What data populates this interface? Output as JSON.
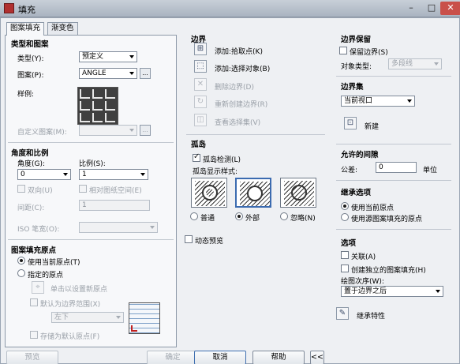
{
  "window": {
    "title": "填充",
    "minimize": "–",
    "maximize": "□",
    "close": "✕"
  },
  "tabs": [
    {
      "label": "图案填充"
    },
    {
      "label": "渐变色"
    }
  ],
  "type_pattern": {
    "group_title": "类型和图案",
    "type_label": "类型(Y):",
    "type_value": "预定义",
    "pattern_label": "图案(P):",
    "pattern_value": "ANGLE",
    "pattern_browse": "...",
    "sample_label": "样例:",
    "custom_label": "自定义图案(M):",
    "custom_value": "",
    "custom_browse": "..."
  },
  "angle_scale": {
    "group_title": "角度和比例",
    "angle_label": "角度(G):",
    "angle_value": "0",
    "scale_label": "比例(S):",
    "scale_value": "1",
    "double_label": "双向(U)",
    "relative_label": "相对图纸空间(E)",
    "spacing_label": "间距(C):",
    "spacing_value": "1",
    "iso_label": "ISO 笔宽(O):",
    "iso_value": ""
  },
  "origin": {
    "group_title": "图案填充原点",
    "use_current": "使用当前原点(T)",
    "specified": "指定的原点",
    "click_set": "单击以设置新原点",
    "default_extent": "默认为边界范围(X)",
    "extent_value": "左下",
    "store_default": "存储为默认原点(F)"
  },
  "boundaries": {
    "group_title": "边界",
    "add_pick": "添加:拾取点(K)",
    "add_select": "添加:选择对象(B)",
    "remove": "删除边界(D)",
    "recreate": "重新创建边界(R)",
    "view_set": "查看选择集(V)"
  },
  "islands": {
    "group_title": "孤岛",
    "detect_label": "孤岛检测(L)",
    "style_label": "孤岛显示样式:",
    "normal": "普通",
    "outer": "外部",
    "ignore": "忽略(N)",
    "selected": "outer"
  },
  "dynamic_preview": "动态预览",
  "boundary_retention": {
    "group_title": "边界保留",
    "retain_label": "保留边界(S)",
    "object_type_label": "对象类型:",
    "object_type_value": "多段线"
  },
  "boundary_set": {
    "group_title": "边界集",
    "value": "当前视口",
    "new_label": "新建"
  },
  "gap": {
    "group_title": "允许的间隙",
    "tolerance_label": "公差:",
    "value": "0",
    "unit": "单位"
  },
  "inherit_options": {
    "group_title": "继承选项",
    "use_current": "使用当前原点",
    "use_source": "使用源图案填充的原点"
  },
  "options": {
    "group_title": "选项",
    "associative": "关联(A)",
    "separate": "创建独立的图案填充(H)",
    "draw_order_label": "绘图次序(W):",
    "draw_order_value": "置于边界之后"
  },
  "inherit_properties": "继承特性",
  "footer": {
    "preview": "预览",
    "ok": "确定",
    "cancel": "取消",
    "help": "帮助",
    "collapse": "<<"
  }
}
